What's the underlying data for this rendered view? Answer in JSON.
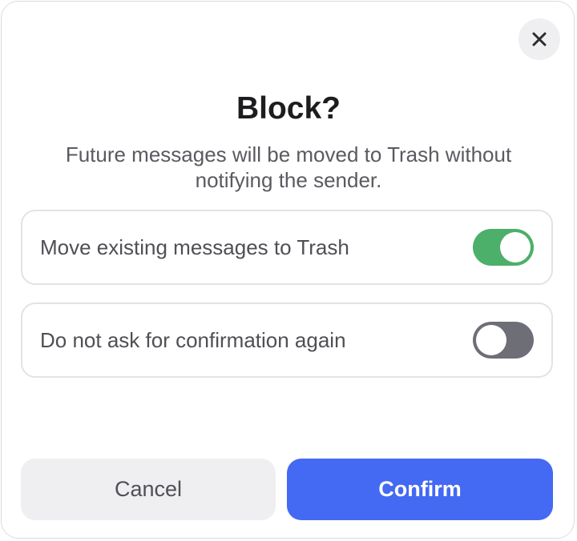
{
  "dialog": {
    "title": "Block?",
    "description": "Future messages will be moved to Trash without notifying the sender.",
    "close_icon": "close-icon"
  },
  "options": [
    {
      "label": "Move existing messages to Trash",
      "enabled": true
    },
    {
      "label": "Do not ask for confirmation again",
      "enabled": false
    }
  ],
  "buttons": {
    "cancel_label": "Cancel",
    "confirm_label": "Confirm"
  },
  "colors": {
    "accent": "#4469f2",
    "toggle_on": "#4caf6a",
    "toggle_off": "#6e6e76"
  }
}
